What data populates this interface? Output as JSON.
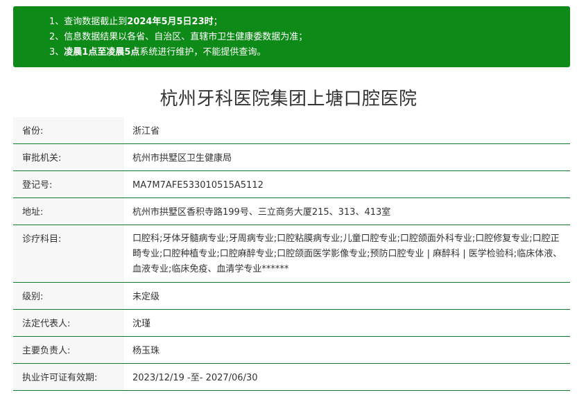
{
  "notice": {
    "line1_prefix": "1、查询数据截止到",
    "line1_bold": "2024年5月5日23时",
    "line1_suffix": "；",
    "line2": "2、信息数据结果以各省、自治区、直辖市卫生健康委数据为准；",
    "line3_prefix": "3、",
    "line3_bold": "凌晨1点至凌晨5点",
    "line3_suffix": "系统进行维护，不能提供查询。"
  },
  "title": "杭州牙科医院集团上塘口腔医院",
  "rows": [
    {
      "label": "省份:",
      "value": "浙江省"
    },
    {
      "label": "审批机关:",
      "value": "杭州市拱墅区卫生健康局"
    },
    {
      "label": "登记号:",
      "value": "MA7M7AFE533010515A5112"
    },
    {
      "label": "地址:",
      "value": "杭州市拱墅区香积寺路199号、三立商务大厦215、313、413室"
    },
    {
      "label": "诊疗科目:",
      "value": "口腔科;牙体牙髓病专业;牙周病专业;口腔粘膜病专业;儿童口腔专业;口腔颌面外科专业;口腔修复专业;口腔正畸专业;口腔种植专业;口腔麻醉专业;口腔颌面医学影像专业;预防口腔专业 | 麻醉科 | 医学检验科;临床体液、血液专业;临床免疫、血清学专业******"
    },
    {
      "label": "级别:",
      "value": "未定级"
    },
    {
      "label": "法定代表人:",
      "value": "沈瑾"
    },
    {
      "label": "主要负责人:",
      "value": "杨玉珠"
    },
    {
      "label": "执业许可证有效期:",
      "value": "2023/12/19 -至- 2027/06/30"
    }
  ]
}
